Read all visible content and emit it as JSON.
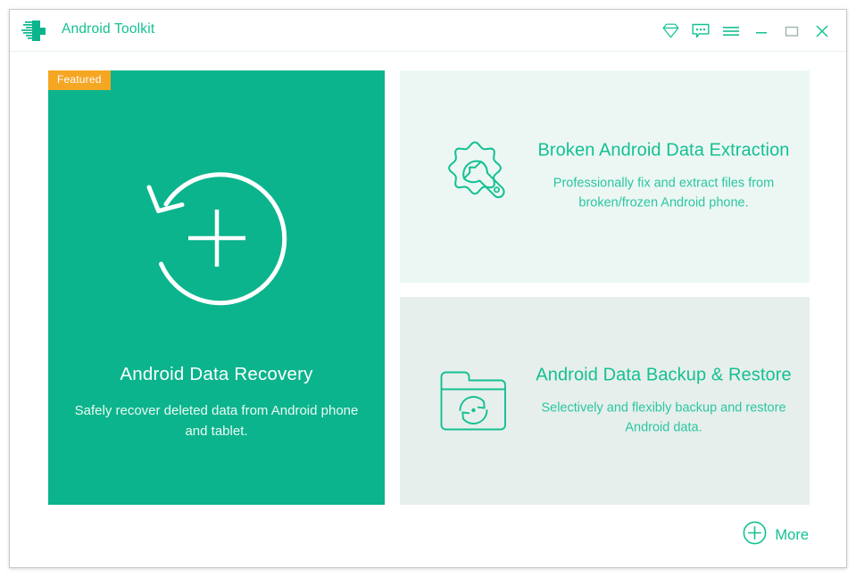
{
  "window": {
    "title": "Android Toolkit",
    "logo_icon": "green-cross-logo-icon"
  },
  "titlebar": {
    "actions": [
      {
        "name": "diamond-icon",
        "label": "Diamond"
      },
      {
        "name": "feedback-icon",
        "label": "Feedback"
      },
      {
        "name": "hamburger-menu-icon",
        "label": "Menu"
      },
      {
        "name": "minimize-icon",
        "label": "Minimize"
      },
      {
        "name": "maximize-icon",
        "label": "Maximize"
      },
      {
        "name": "close-icon",
        "label": "Close"
      }
    ]
  },
  "hero": {
    "badge": "Featured",
    "title": "Android Data Recovery",
    "description": "Safely recover deleted data from Android phone and tablet.",
    "icon": "circular-arrow-plus-icon"
  },
  "cards": [
    {
      "id": "broken-android-data-extraction",
      "title": "Broken Android Data Extraction",
      "description": "Professionally fix and extract files from broken/frozen Android phone.",
      "icon": "gear-wrench-icon",
      "background": "#ecf7f4"
    },
    {
      "id": "android-data-backup-restore",
      "title": "Android Data Backup & Restore",
      "description": "Selectively and flexibly backup and restore Android data.",
      "icon": "folder-sync-icon",
      "background": "#e7efec"
    }
  ],
  "footer": {
    "more_label": "More",
    "more_icon": "plus-circle-icon"
  },
  "colors": {
    "brand_teal": "#0bb48c",
    "accent_text": "#14c092",
    "badge_orange": "#f5a623",
    "card_light_mint": "#ecf7f4",
    "card_light_gray": "#e7efec"
  }
}
